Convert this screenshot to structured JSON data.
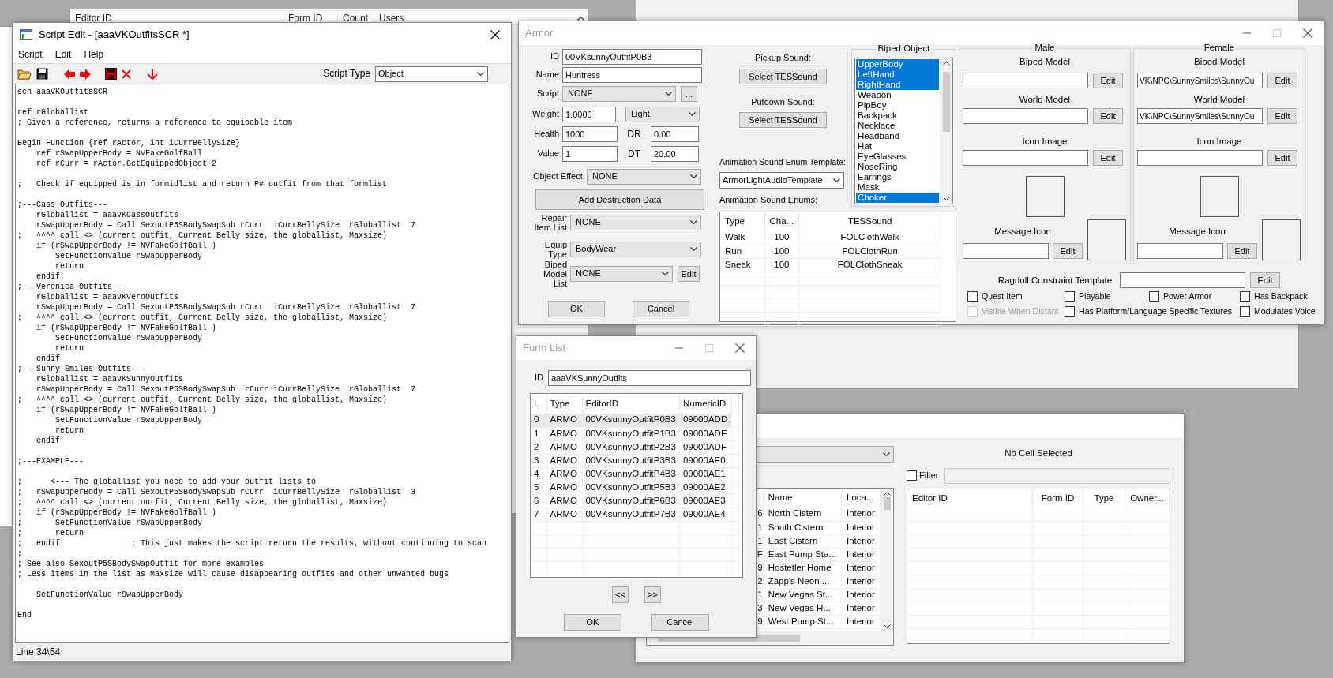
{
  "background_window": {
    "columns": [
      "Editor ID",
      "Form ID",
      "Count",
      "Users"
    ]
  },
  "script_edit": {
    "title": "Script Edit - [aaaVKOutfitsSCR *]",
    "menu": [
      "Script",
      "Edit",
      "Help"
    ],
    "script_type_label": "Script Type",
    "script_type": "Object",
    "text": "scn aaaVKOutfitsSCR\n\nref rGloballist\n; Given a reference, returns a reference to equipable item\n\nBegin Function {ref rActor, int iCurrBellySize}\n    ref rSwapUpperBody = NVFakeGolfBall\n    ref rCurr = rActor.GetEquippedObject 2\n\n;   Check if equipped is in formidlist and return P# outfit from that formlist\n\n;---Cass Outfits---\n    rGloballist = aaaVKCassOutfits\n    rSwapUpperBody = Call SexoutP5SBodySwapSub rCurr  iCurrBellySize  rGloballist  7\n;   ^^^^ call <> (current outfit, Current Belly size, the globallist, Maxsize)\n    if (rSwapUpperBody != NVFakeGolfBall )\n        SetFunctionValue rSwapUpperBody\n        return\n    endif\n;---Veronica Outfits---\n    rGloballist = aaaVKVeroOutfits\n    rSwapUpperBody = Call SexoutP5SBodySwapSub rCurr  iCurrBellySize  rGloballist  7\n;   ^^^^ call <> (current outfit, Current Belly size, the globallist, Maxsize)\n    if (rSwapUpperBody != NVFakeGolfBall )\n        SetFunctionValue rSwapUpperBody\n        return\n    endif\n;---Sunny Smiles Outfits---\n    rGloballist = aaaVKSunnyOutfits\n    rSwapUpperBody = Call SexoutP5SBodySwapSub  rCurr iCurrBellySize  rGloballist  7\n;   ^^^^ call <> (current outfit, Current Belly size, the globallist, Maxsize)\n    if (rSwapUpperBody != NVFakeGolfBall )\n        SetFunctionValue rSwapUpperBody\n        return\n    endif\n\n;---EXAMPLE---\n\n;      <--- The globallist you need to add your outfit lists to\n;   rSwapUpperBody = Call SexoutP5SBodySwapSub rCurr  iCurrBellySize  rGloballist  3\n;   ^^^^ call <> (current outfit, Current Belly size, the globallist, Maxsize)\n;   if (rSwapUpperBody != NVFakeGolfBall )\n;       SetFunctionValue rSwapUpperBody\n;       return\n;   endif               ; This just makes the script return the results, without continuing to scan\n;\n; See also SexoutP5SBodySwapOutfit for more examples\n; Less items in the list as Maxsize will cause disappearing outfits and other unwanted bugs\n\n    SetFunctionValue rSwapUpperBody\n\nEnd",
    "status": "Line 34\\54"
  },
  "armor": {
    "title": "Armor",
    "id": {
      "label": "ID",
      "value": "00VKsunnyOutfitP0B3"
    },
    "name": {
      "label": "Name",
      "value": "Huntress"
    },
    "script": {
      "label": "Script",
      "value": "NONE",
      "button": "..."
    },
    "weight": {
      "label": "Weight",
      "value": "1.0000",
      "class": "Light"
    },
    "health": {
      "label": "Health",
      "value": "1000"
    },
    "dr": {
      "label": "DR",
      "value": "0.00"
    },
    "value": {
      "label": "Value",
      "value": "1"
    },
    "dt": {
      "label": "DT",
      "value": "20.00"
    },
    "object_effect": {
      "label": "Object Effect",
      "value": "NONE"
    },
    "destruction_button": "Add Destruction Data",
    "repair_list": {
      "label": "Repair Item List",
      "value": "NONE"
    },
    "equip_type": {
      "label": "Equip Type",
      "value": "BodyWear"
    },
    "biped_model_list": {
      "label": "Biped Model List",
      "value": "NONE",
      "button": "Edit"
    },
    "buttons": [
      "OK",
      "Cancel"
    ],
    "pickup_label": "Pickup Sound:",
    "pickup_button": "Select TESSound",
    "putdown_label": "Putdown Sound:",
    "putdown_button": "Select TESSound",
    "template_label": "Animation Sound Enum Template:",
    "template": "ArmorLightAudioTemplate",
    "enums_label": "Animation Sound Enums:",
    "enums_table": {
      "columns": [
        "Type",
        "Cha...",
        "TESSound"
      ],
      "rows": [
        [
          "Walk",
          "100",
          "FOLClothWalk"
        ],
        [
          "Run",
          "100",
          "FOLClothRun"
        ],
        [
          "Sneak",
          "100",
          "FOLClothSneak"
        ]
      ]
    },
    "biped_object": {
      "label": "Biped Object",
      "items": [
        {
          "label": "UpperBody",
          "selected": true
        },
        {
          "label": "LeftHand",
          "selected": true
        },
        {
          "label": "RightHand",
          "selected": true
        },
        {
          "label": "Weapon",
          "selected": false
        },
        {
          "label": "PipBoy",
          "selected": false
        },
        {
          "label": "Backpack",
          "selected": false
        },
        {
          "label": "Necklace",
          "selected": false
        },
        {
          "label": "Headband",
          "selected": false
        },
        {
          "label": "Hat",
          "selected": false
        },
        {
          "label": "EyeGlasses",
          "selected": false
        },
        {
          "label": "NoseRing",
          "selected": false
        },
        {
          "label": "Earrings",
          "selected": false
        },
        {
          "label": "Mask",
          "selected": false
        },
        {
          "label": "Choker",
          "selected": true
        }
      ]
    },
    "male": {
      "label": "Male",
      "models": [
        {
          "label": "Biped Model",
          "button": "Edit"
        },
        {
          "label": "World Model",
          "button": "Edit"
        },
        {
          "label": "Icon Image",
          "button": "Edit"
        }
      ],
      "message_icon": {
        "label": "Message Icon",
        "button": "Edit"
      }
    },
    "female": {
      "label": "Female",
      "models": [
        {
          "label": "Biped Model",
          "value": "VK\\NPC\\SunnySmiles\\SunnyOu",
          "button": "Edit"
        },
        {
          "label": "World Model",
          "value": "VK\\NPC\\SunnySmiles\\SunnyOu",
          "button": "Edit"
        },
        {
          "label": "Icon Image",
          "button": "Edit"
        }
      ],
      "message_icon": {
        "label": "Message Icon",
        "button": "Edit"
      }
    },
    "ragdoll": {
      "label": "Ragdoll Constraint Template",
      "button": "Edit"
    },
    "flags": [
      {
        "label": "Quest Item",
        "checked": false,
        "disabled": false
      },
      {
        "label": "Playable",
        "checked": false,
        "disabled": false
      },
      {
        "label": "Power Armor",
        "checked": false,
        "disabled": false
      },
      {
        "label": "Has Backpack",
        "checked": false,
        "disabled": false
      },
      {
        "label": "Visible When Distant",
        "checked": false,
        "disabled": true
      },
      {
        "label": "Has Platform/Language Specific Textures",
        "checked": false,
        "disabled": false
      },
      {
        "label": "Modulates Voice",
        "checked": false,
        "disabled": false
      }
    ]
  },
  "form_list": {
    "title": "Form List",
    "id_label": "ID",
    "id": "aaaVKSunnyOutfits",
    "columns": [
      "I.",
      "Type",
      "EditorID",
      "NumericID"
    ],
    "rows": [
      {
        "cells": [
          "0",
          "ARMO",
          "00VKsunnyOutfitP0B3",
          "09000ADD"
        ],
        "selected": true
      },
      {
        "cells": [
          "1",
          "ARMO",
          "00VKsunnyOutfitP1B3",
          "09000ADE"
        ],
        "selected": false
      },
      {
        "cells": [
          "2",
          "ARMO",
          "00VKsunnyOutfitP2B3",
          "09000ADF"
        ],
        "selected": false
      },
      {
        "cells": [
          "3",
          "ARMO",
          "00VKsunnyOutfitP3B3",
          "09000AE0"
        ],
        "selected": false
      },
      {
        "cells": [
          "4",
          "ARMO",
          "00VKsunnyOutfitP4B3",
          "09000AE1"
        ],
        "selected": false
      },
      {
        "cells": [
          "5",
          "ARMO",
          "00VKsunnyOutfitP5B3",
          "09000AE2"
        ],
        "selected": false
      },
      {
        "cells": [
          "6",
          "ARMO",
          "00VKsunnyOutfitP6B3",
          "09000AE3"
        ],
        "selected": false
      },
      {
        "cells": [
          "7",
          "ARMO",
          "00VKsunnyOutfitP7B3",
          "09000AE4"
        ],
        "selected": false
      }
    ],
    "nav_buttons": [
      "<<",
      ">>"
    ],
    "buttons": [
      "OK",
      "Cancel"
    ]
  },
  "cell_view": {
    "status": "No Cell Selected",
    "filter_label": "Filter",
    "filter_checked": false,
    "cell_table": {
      "columns": [
        "",
        "Name",
        "Loca..."
      ],
      "rows": [
        [
          "6",
          "North Cistern",
          "Interior"
        ],
        [
          "1",
          "South Cistern",
          "Interior"
        ],
        [
          "1",
          "East Cistern",
          "Interior"
        ],
        [
          "F",
          "East Pump Sta...",
          "Interior"
        ],
        [
          "9",
          "Hostetler Home",
          "Interior"
        ],
        [
          "2",
          "Zapp's Neon ...",
          "Interior"
        ],
        [
          "1",
          "New Vegas St...",
          "Interior"
        ],
        [
          "3",
          "New Vegas H...",
          "Interior"
        ],
        [
          "9",
          "West Pump St...",
          "Interior"
        ]
      ]
    },
    "object_table": {
      "columns": [
        "Editor ID",
        "Form ID",
        "Type",
        "Owner..."
      ]
    }
  }
}
